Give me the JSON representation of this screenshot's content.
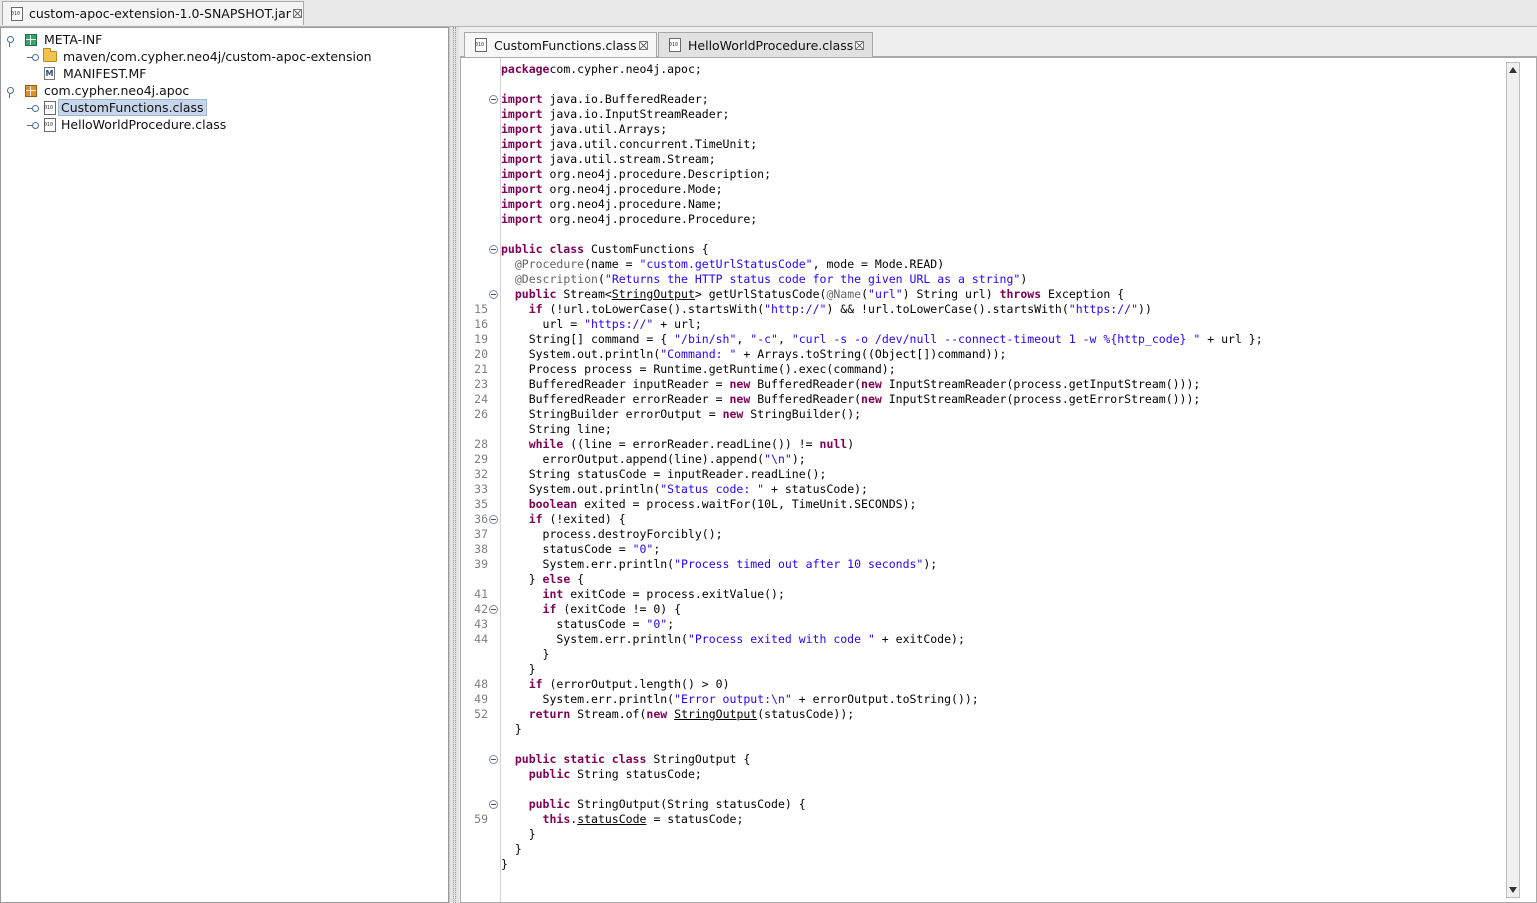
{
  "top_tab": {
    "label": "custom-apoc-extension-1.0-SNAPSHOT.jar"
  },
  "tree": {
    "meta_inf": "META-INF",
    "maven_folder": "maven/com.cypher.neo4j/custom-apoc-extension",
    "manifest": "MANIFEST.MF",
    "manifest_icon_letter": "M",
    "package": "com.cypher.neo4j.apoc",
    "custom_functions": "CustomFunctions.class",
    "hello_world": "HelloWorldProcedure.class"
  },
  "editor_tabs": [
    {
      "label": "CustomFunctions.class",
      "active": true
    },
    {
      "label": "HelloWorldProcedure.class",
      "active": false
    }
  ],
  "colors": {
    "keyword": "#7f0055",
    "string": "#2a00ff",
    "annotation": "#646464",
    "selection": "#c7d6ea"
  },
  "icons": {
    "jar": "class-file-icon",
    "package_meta": "package-icon",
    "package_main": "package-icon",
    "folder": "folder-icon",
    "manifest": "manifest-icon",
    "class": "class-file-icon",
    "close": "close-icon",
    "scroll_up": "arrow-up-icon",
    "scroll_down": "arrow-down-icon"
  },
  "code": {
    "lines": [
      {
        "no": "",
        "fold": false,
        "tokens": [
          [
            "kw",
            "package"
          ],
          [
            "",
            "com.cypher.neo4j.apoc;"
          ]
        ]
      },
      {
        "no": "",
        "fold": false,
        "tokens": []
      },
      {
        "no": "",
        "fold": true,
        "tokens": [
          [
            "kw",
            "import"
          ],
          [
            "",
            " java.io.BufferedReader;"
          ]
        ]
      },
      {
        "no": "",
        "fold": false,
        "tokens": [
          [
            "kw",
            "import"
          ],
          [
            "",
            " java.io.InputStreamReader;"
          ]
        ]
      },
      {
        "no": "",
        "fold": false,
        "tokens": [
          [
            "kw",
            "import"
          ],
          [
            "",
            " java.util.Arrays;"
          ]
        ]
      },
      {
        "no": "",
        "fold": false,
        "tokens": [
          [
            "kw",
            "import"
          ],
          [
            "",
            " java.util.concurrent.TimeUnit;"
          ]
        ]
      },
      {
        "no": "",
        "fold": false,
        "tokens": [
          [
            "kw",
            "import"
          ],
          [
            "",
            " java.util.stream.Stream;"
          ]
        ]
      },
      {
        "no": "",
        "fold": false,
        "tokens": [
          [
            "kw",
            "import"
          ],
          [
            "",
            " org.neo4j.procedure.Description;"
          ]
        ]
      },
      {
        "no": "",
        "fold": false,
        "tokens": [
          [
            "kw",
            "import"
          ],
          [
            "",
            " org.neo4j.procedure.Mode;"
          ]
        ]
      },
      {
        "no": "",
        "fold": false,
        "tokens": [
          [
            "kw",
            "import"
          ],
          [
            "",
            " org.neo4j.procedure.Name;"
          ]
        ]
      },
      {
        "no": "",
        "fold": false,
        "tokens": [
          [
            "kw",
            "import"
          ],
          [
            "",
            " org.neo4j.procedure.Procedure;"
          ]
        ]
      },
      {
        "no": "",
        "fold": false,
        "tokens": []
      },
      {
        "no": "",
        "fold": true,
        "tokens": [
          [
            "kw",
            "public class"
          ],
          [
            "",
            " CustomFunctions {"
          ]
        ]
      },
      {
        "no": "",
        "fold": false,
        "tokens": [
          [
            "",
            "  "
          ],
          [
            "an",
            "@Procedure"
          ],
          [
            "",
            "(name = "
          ],
          [
            "st",
            "\"custom.getUrlStatusCode\""
          ],
          [
            "",
            ", mode = Mode.READ)"
          ]
        ]
      },
      {
        "no": "",
        "fold": false,
        "tokens": [
          [
            "",
            "  "
          ],
          [
            "an",
            "@Description"
          ],
          [
            "",
            "("
          ],
          [
            "st",
            "\"Returns the HTTP status code for the given URL as a string\""
          ],
          [
            "",
            ")"
          ]
        ]
      },
      {
        "no": "",
        "fold": true,
        "tokens": [
          [
            "",
            "  "
          ],
          [
            "kw",
            "public"
          ],
          [
            "",
            " Stream<"
          ],
          [
            "ul",
            "StringOutput"
          ],
          [
            "",
            "> getUrlStatusCode("
          ],
          [
            "an",
            "@Name"
          ],
          [
            "",
            "("
          ],
          [
            "st",
            "\"url\""
          ],
          [
            "",
            ") String url) "
          ],
          [
            "kw",
            "throws"
          ],
          [
            "",
            " Exception {"
          ]
        ]
      },
      {
        "no": "15",
        "fold": false,
        "tokens": [
          [
            "",
            "    "
          ],
          [
            "kw",
            "if"
          ],
          [
            "",
            " (!url.toLowerCase().startsWith("
          ],
          [
            "st",
            "\"http://\""
          ],
          [
            "",
            ") && !url.toLowerCase().startsWith("
          ],
          [
            "st",
            "\"https://\""
          ],
          [
            "",
            "))"
          ]
        ]
      },
      {
        "no": "16",
        "fold": false,
        "tokens": [
          [
            "",
            "      url = "
          ],
          [
            "st",
            "\"https://\""
          ],
          [
            "",
            " + url;"
          ]
        ]
      },
      {
        "no": "19",
        "fold": false,
        "tokens": [
          [
            "",
            "    String[] command = { "
          ],
          [
            "st",
            "\"/bin/sh\""
          ],
          [
            "",
            ", "
          ],
          [
            "st",
            "\"-c\""
          ],
          [
            "",
            ", "
          ],
          [
            "st",
            "\"curl -s -o /dev/null --connect-timeout 1 -w %{http_code} \""
          ],
          [
            "",
            " + url };"
          ]
        ]
      },
      {
        "no": "20",
        "fold": false,
        "tokens": [
          [
            "",
            "    System.out.println("
          ],
          [
            "st",
            "\"Command: \""
          ],
          [
            "",
            " + Arrays.toString((Object[])command));"
          ]
        ]
      },
      {
        "no": "21",
        "fold": false,
        "tokens": [
          [
            "",
            "    Process process = Runtime.getRuntime().exec(command);"
          ]
        ]
      },
      {
        "no": "23",
        "fold": false,
        "tokens": [
          [
            "",
            "    BufferedReader inputReader = "
          ],
          [
            "kw",
            "new"
          ],
          [
            "",
            " BufferedReader("
          ],
          [
            "kw",
            "new"
          ],
          [
            "",
            " InputStreamReader(process.getInputStream()));"
          ]
        ]
      },
      {
        "no": "24",
        "fold": false,
        "tokens": [
          [
            "",
            "    BufferedReader errorReader = "
          ],
          [
            "kw",
            "new"
          ],
          [
            "",
            " BufferedReader("
          ],
          [
            "kw",
            "new"
          ],
          [
            "",
            " InputStreamReader(process.getErrorStream()));"
          ]
        ]
      },
      {
        "no": "26",
        "fold": false,
        "tokens": [
          [
            "",
            "    StringBuilder errorOutput = "
          ],
          [
            "kw",
            "new"
          ],
          [
            "",
            " StringBuilder();"
          ]
        ]
      },
      {
        "no": "",
        "fold": false,
        "tokens": [
          [
            "",
            "    String line;"
          ]
        ]
      },
      {
        "no": "28",
        "fold": false,
        "tokens": [
          [
            "",
            "    "
          ],
          [
            "kw",
            "while"
          ],
          [
            "",
            " ((line = errorReader.readLine()) != "
          ],
          [
            "kw",
            "null"
          ],
          [
            "",
            ")"
          ]
        ]
      },
      {
        "no": "29",
        "fold": false,
        "tokens": [
          [
            "",
            "      errorOutput.append(line).append("
          ],
          [
            "st",
            "\"\\n\""
          ],
          [
            "",
            ");"
          ]
        ]
      },
      {
        "no": "32",
        "fold": false,
        "tokens": [
          [
            "",
            "    String statusCode = inputReader.readLine();"
          ]
        ]
      },
      {
        "no": "33",
        "fold": false,
        "tokens": [
          [
            "",
            "    System.out.println("
          ],
          [
            "st",
            "\"Status code: \""
          ],
          [
            "",
            " + statusCode);"
          ]
        ]
      },
      {
        "no": "35",
        "fold": false,
        "tokens": [
          [
            "",
            "    "
          ],
          [
            "kw",
            "boolean"
          ],
          [
            "",
            " exited = process.waitFor(10L, TimeUnit.SECONDS);"
          ]
        ]
      },
      {
        "no": "36",
        "fold": true,
        "tokens": [
          [
            "",
            "    "
          ],
          [
            "kw",
            "if"
          ],
          [
            "",
            " (!exited) {"
          ]
        ]
      },
      {
        "no": "37",
        "fold": false,
        "tokens": [
          [
            "",
            "      process.destroyForcibly();"
          ]
        ]
      },
      {
        "no": "38",
        "fold": false,
        "tokens": [
          [
            "",
            "      statusCode = "
          ],
          [
            "st",
            "\"0\""
          ],
          [
            "",
            ";"
          ]
        ]
      },
      {
        "no": "39",
        "fold": false,
        "tokens": [
          [
            "",
            "      System.err.println("
          ],
          [
            "st",
            "\"Process timed out after 10 seconds\""
          ],
          [
            "",
            ");"
          ]
        ]
      },
      {
        "no": "",
        "fold": false,
        "tokens": [
          [
            "",
            "    } "
          ],
          [
            "kw",
            "else"
          ],
          [
            "",
            " {"
          ]
        ]
      },
      {
        "no": "41",
        "fold": false,
        "tokens": [
          [
            "",
            "      "
          ],
          [
            "kw",
            "int"
          ],
          [
            "",
            " exitCode = process.exitValue();"
          ]
        ]
      },
      {
        "no": "42",
        "fold": true,
        "tokens": [
          [
            "",
            "      "
          ],
          [
            "kw",
            "if"
          ],
          [
            "",
            " (exitCode != 0) {"
          ]
        ]
      },
      {
        "no": "43",
        "fold": false,
        "tokens": [
          [
            "",
            "        statusCode = "
          ],
          [
            "st",
            "\"0\""
          ],
          [
            "",
            ";"
          ]
        ]
      },
      {
        "no": "44",
        "fold": false,
        "tokens": [
          [
            "",
            "        System.err.println("
          ],
          [
            "st",
            "\"Process exited with code \""
          ],
          [
            "",
            " + exitCode);"
          ]
        ]
      },
      {
        "no": "",
        "fold": false,
        "tokens": [
          [
            "",
            "      }"
          ]
        ]
      },
      {
        "no": "",
        "fold": false,
        "tokens": [
          [
            "",
            "    }"
          ]
        ]
      },
      {
        "no": "48",
        "fold": false,
        "tokens": [
          [
            "",
            "    "
          ],
          [
            "kw",
            "if"
          ],
          [
            "",
            " (errorOutput.length() > 0)"
          ]
        ]
      },
      {
        "no": "49",
        "fold": false,
        "tokens": [
          [
            "",
            "      System.err.println("
          ],
          [
            "st",
            "\"Error output:\\n\""
          ],
          [
            "",
            " + errorOutput.toString());"
          ]
        ]
      },
      {
        "no": "52",
        "fold": false,
        "tokens": [
          [
            "",
            "    "
          ],
          [
            "kw",
            "return"
          ],
          [
            "",
            " Stream.of("
          ],
          [
            "kw",
            "new"
          ],
          [
            "",
            " "
          ],
          [
            "ul",
            "StringOutput"
          ],
          [
            "",
            "(statusCode));"
          ]
        ]
      },
      {
        "no": "",
        "fold": false,
        "tokens": [
          [
            "",
            "  }"
          ]
        ]
      },
      {
        "no": "",
        "fold": false,
        "tokens": []
      },
      {
        "no": "",
        "fold": true,
        "tokens": [
          [
            "",
            "  "
          ],
          [
            "kw",
            "public static class"
          ],
          [
            "",
            " StringOutput {"
          ]
        ]
      },
      {
        "no": "",
        "fold": false,
        "tokens": [
          [
            "",
            "    "
          ],
          [
            "kw",
            "public"
          ],
          [
            "",
            " String statusCode;"
          ]
        ]
      },
      {
        "no": "",
        "fold": false,
        "tokens": []
      },
      {
        "no": "",
        "fold": true,
        "tokens": [
          [
            "",
            "    "
          ],
          [
            "kw",
            "public"
          ],
          [
            "",
            " StringOutput(String statusCode) {"
          ]
        ]
      },
      {
        "no": "59",
        "fold": false,
        "tokens": [
          [
            "",
            "      "
          ],
          [
            "kw",
            "this"
          ],
          [
            "",
            "."
          ],
          [
            "ul",
            "statusCode"
          ],
          [
            "",
            " = statusCode;"
          ]
        ]
      },
      {
        "no": "",
        "fold": false,
        "tokens": [
          [
            "",
            "    }"
          ]
        ]
      },
      {
        "no": "",
        "fold": false,
        "tokens": [
          [
            "",
            "  }"
          ]
        ]
      },
      {
        "no": "",
        "fold": false,
        "tokens": [
          [
            "",
            "}"
          ]
        ]
      }
    ]
  }
}
